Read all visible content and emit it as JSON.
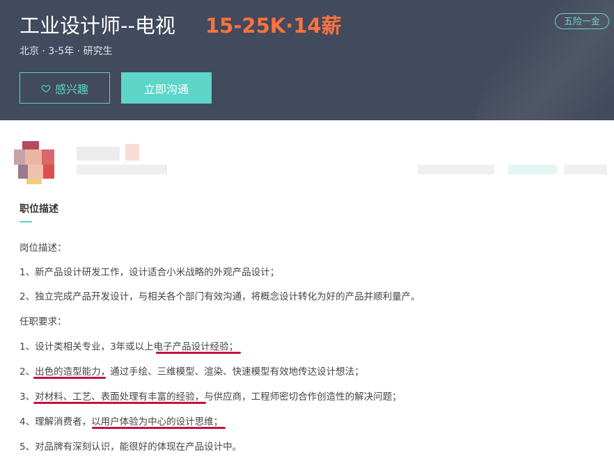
{
  "header": {
    "title": "工业设计师--电视",
    "salary": "15-25K·14薪",
    "meta": "北京 · 3-5年 · 研究生",
    "benefit": "五险一金",
    "interest_button": "感兴趣",
    "chat_button": "立即沟通"
  },
  "section": {
    "title": "职位描述"
  },
  "description": [
    "岗位描述：",
    "1、新产品设计研发工作，设计适合小米战略的外观产品设计；",
    "2、独立完成产品开发设计，与相关各个部门有效沟通，将概念设计转化为好的产品并顺利量产。",
    "任职要求：",
    "1、设计类相关专业，3年或以上电子产品设计经验；",
    "2、出色的造型能力，通过手绘、三维模型、渲染、快速模型有效地传达设计想法；",
    "3、对材料、工艺、表面处理有丰富的经验，与供应商，工程师密切合作创造性的解决问题；",
    "4、理解消费者，以用户体验为中心的设计思维；",
    "5、对品牌有深刻认识，能很好的体现在产品设计中。"
  ],
  "colors": {
    "header_bg": "#424a5d",
    "accent": "#5dd5c8",
    "salary": "#fd7240",
    "annotation": "#c3133d"
  }
}
